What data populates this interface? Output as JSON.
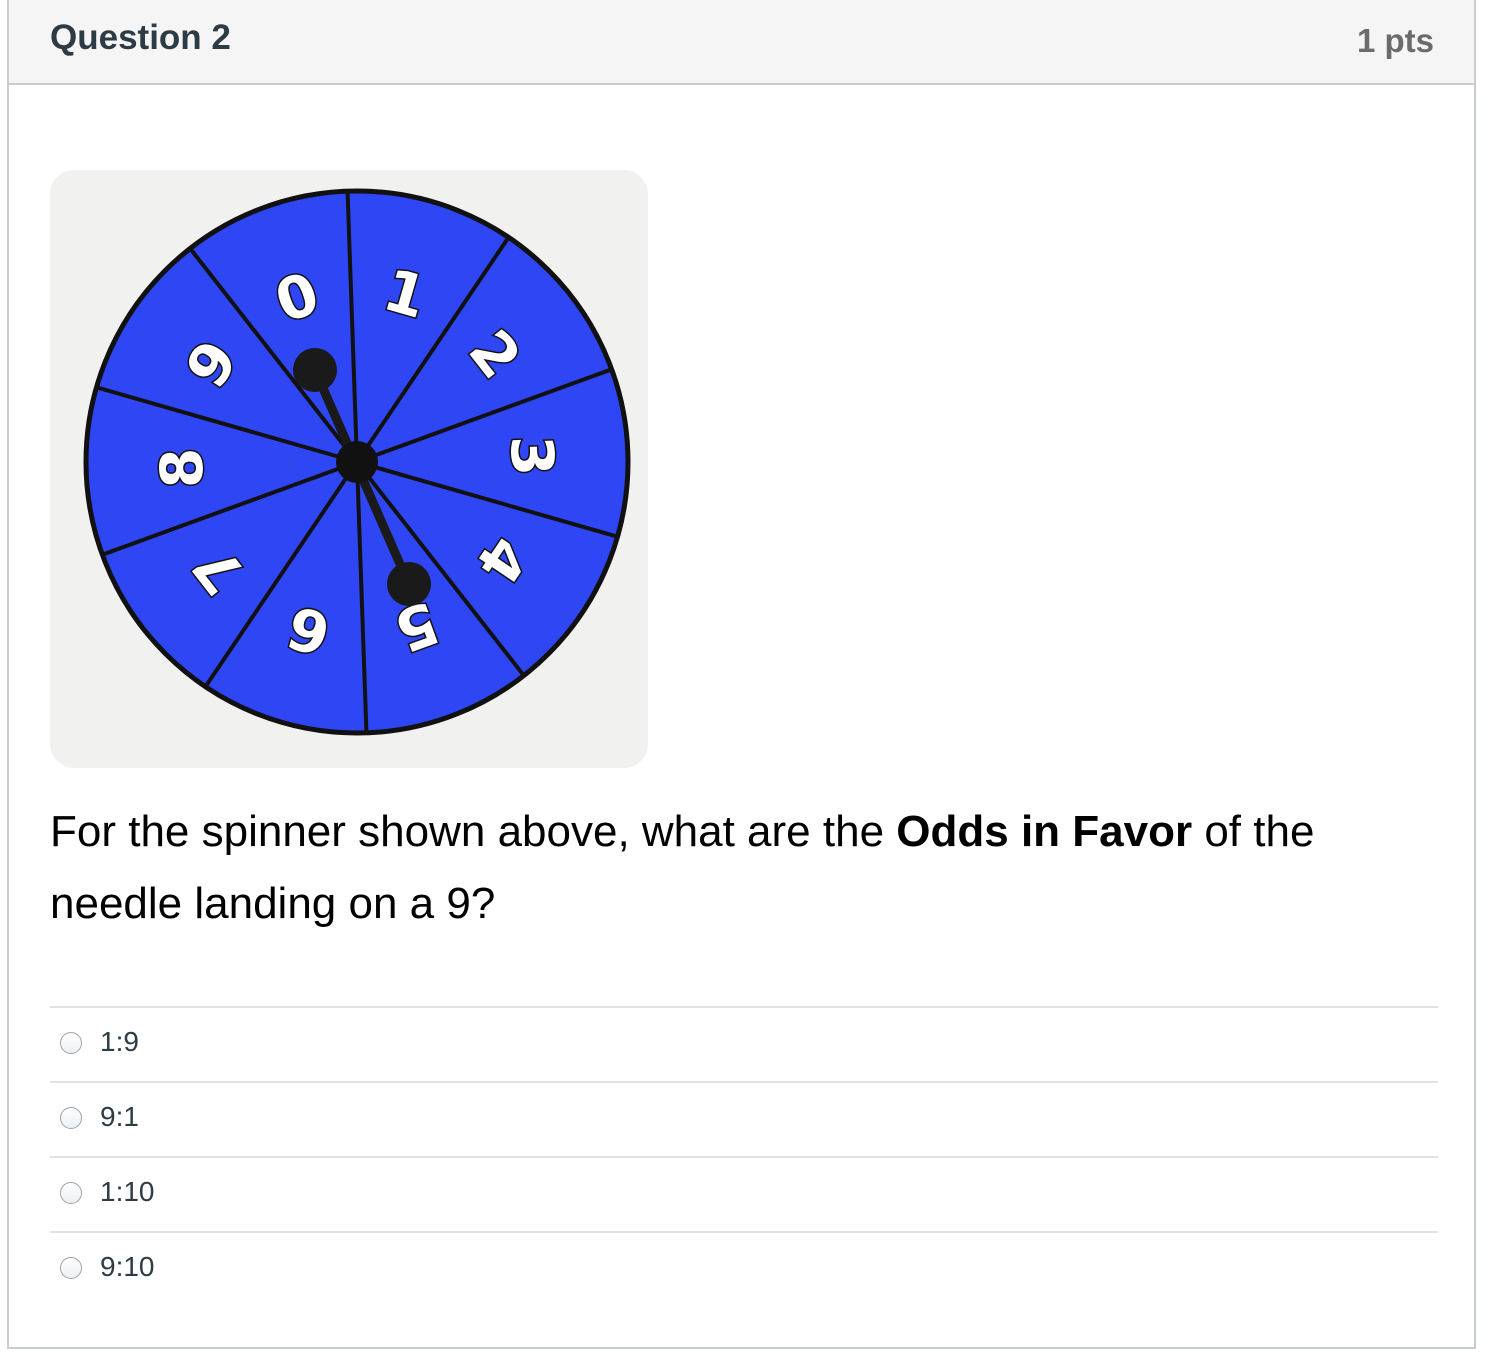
{
  "question": {
    "title": "Question 2",
    "points": "1 pts",
    "text_before": "For the spinner shown above, what are the ",
    "text_bold": "Odds in Favor",
    "text_after": " of the needle landing on a 9?"
  },
  "spinner": {
    "numbers": [
      "0",
      "1",
      "2",
      "3",
      "4",
      "5",
      "6",
      "7",
      "8",
      "9"
    ],
    "sector_color": "#2f46f5",
    "background_color": "#f1f1ef"
  },
  "answers": [
    {
      "label": "1:9"
    },
    {
      "label": "9:1"
    },
    {
      "label": "1:10"
    },
    {
      "label": "9:10"
    }
  ]
}
